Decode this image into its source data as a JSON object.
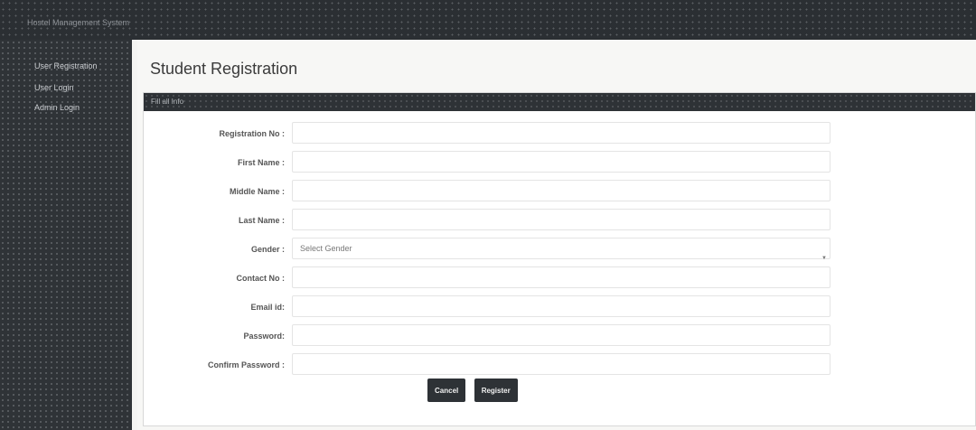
{
  "app": {
    "title": "Hostel Management System"
  },
  "sidebar": {
    "items": [
      {
        "label": "User Registration"
      },
      {
        "label": "User Login"
      },
      {
        "label": "Admin Login"
      }
    ]
  },
  "page": {
    "title": "Student Registration"
  },
  "panel": {
    "header": "Fill all Info"
  },
  "form": {
    "registration_no": {
      "label": "Registration No :",
      "value": ""
    },
    "first_name": {
      "label": "First Name :",
      "value": ""
    },
    "middle_name": {
      "label": "Middle Name :",
      "value": ""
    },
    "last_name": {
      "label": "Last Name :",
      "value": ""
    },
    "gender": {
      "label": "Gender :",
      "selected": "Select Gender"
    },
    "contact_no": {
      "label": "Contact No :",
      "value": ""
    },
    "email": {
      "label": "Email id:",
      "value": ""
    },
    "password": {
      "label": "Password:",
      "value": ""
    },
    "confirm_password": {
      "label": "Confirm Password :",
      "value": ""
    }
  },
  "actions": {
    "cancel": "Cancel",
    "register": "Register"
  },
  "colors": {
    "dark": "#2e3236",
    "background": "#f7f7f5"
  },
  "icons": {
    "caret": "caret-down-icon"
  }
}
